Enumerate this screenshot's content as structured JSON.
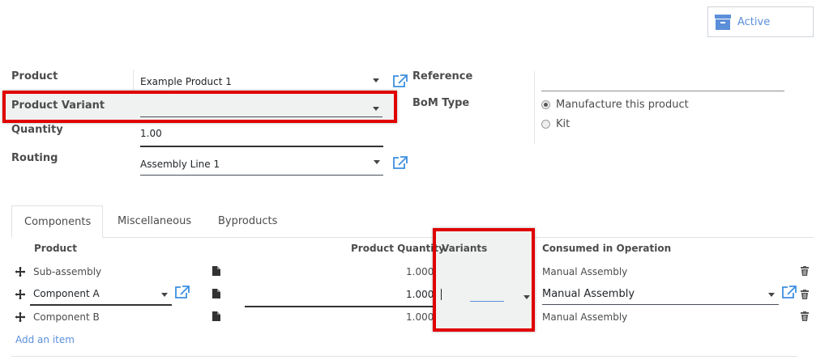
{
  "status_button": {
    "label": "Active"
  },
  "form": {
    "product": {
      "label": "Product",
      "value": "Example Product 1"
    },
    "product_variant": {
      "label": "Product Variant",
      "value": ""
    },
    "quantity": {
      "label": "Quantity",
      "value": "1.00"
    },
    "routing": {
      "label": "Routing",
      "value": "Assembly Line 1"
    },
    "reference": {
      "label": "Reference",
      "value": ""
    },
    "bom_type": {
      "label": "BoM Type",
      "options": [
        {
          "label": "Manufacture this product",
          "selected": true
        },
        {
          "label": "Kit",
          "selected": false
        }
      ]
    }
  },
  "tabs": [
    {
      "label": "Components",
      "active": true
    },
    {
      "label": "Miscellaneous",
      "active": false
    },
    {
      "label": "Byproducts",
      "active": false
    }
  ],
  "table": {
    "headers": {
      "product": "Product",
      "quantity": "Product Quantity",
      "variants": "Variants",
      "operation": "Consumed in Operation"
    },
    "rows": [
      {
        "product": "Sub-assembly",
        "quantity": "1.000",
        "variants": "",
        "operation": "Manual Assembly",
        "editing": false
      },
      {
        "product": "Component A",
        "quantity": "1.000",
        "variants": "",
        "operation": "Manual Assembly",
        "editing": true
      },
      {
        "product": "Component B",
        "quantity": "1.000",
        "variants": "",
        "operation": "Manual Assembly",
        "editing": false
      }
    ],
    "add_item": "Add an item"
  },
  "colors": {
    "accent": "#3d8fe0",
    "highlight": "#e00000",
    "active_icon": "#5b8fd9"
  }
}
